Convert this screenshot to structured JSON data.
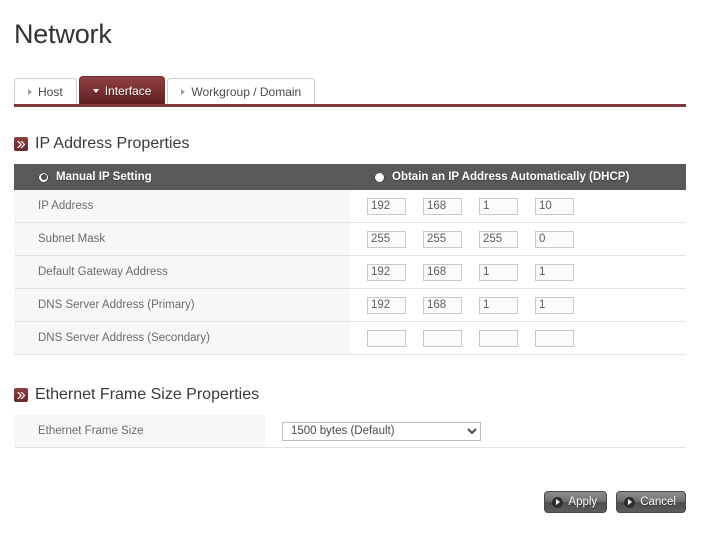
{
  "page": {
    "title": "Network"
  },
  "tabs": [
    {
      "label": "Host",
      "active": false,
      "icon": "triangle-right-icon"
    },
    {
      "label": "Interface",
      "active": true,
      "icon": "triangle-down-icon"
    },
    {
      "label": "Workgroup / Domain",
      "active": false,
      "icon": "triangle-right-icon"
    }
  ],
  "ip_section": {
    "heading": "IP Address Properties",
    "heading_icon": "chevron-double-right-icon",
    "modes": [
      {
        "label": "Manual IP Setting",
        "selected": true
      },
      {
        "label": "Obtain an IP Address Automatically (DHCP)",
        "selected": false
      }
    ],
    "rows": [
      {
        "label": "IP Address",
        "octets": [
          "192",
          "168",
          "1",
          "10"
        ]
      },
      {
        "label": "Subnet Mask",
        "octets": [
          "255",
          "255",
          "255",
          "0"
        ]
      },
      {
        "label": "Default Gateway Address",
        "octets": [
          "192",
          "168",
          "1",
          "1"
        ]
      },
      {
        "label": "DNS Server Address (Primary)",
        "octets": [
          "192",
          "168",
          "1",
          "1"
        ]
      },
      {
        "label": "DNS Server Address (Secondary)",
        "octets": [
          "",
          "",
          "",
          ""
        ]
      }
    ]
  },
  "frame_section": {
    "heading": "Ethernet Frame Size Properties",
    "heading_icon": "chevron-double-right-icon",
    "row_label": "Ethernet Frame Size",
    "selected": "1500 bytes (Default)",
    "options": [
      "1500 bytes (Default)"
    ]
  },
  "buttons": {
    "apply": "Apply",
    "cancel": "Cancel",
    "icon": "play-circle-icon"
  },
  "colors": {
    "accent": "#7c3a3d",
    "tab_active": "#7a3134",
    "table_header": "#595959",
    "row_label_bg": "#f7f7f7"
  }
}
